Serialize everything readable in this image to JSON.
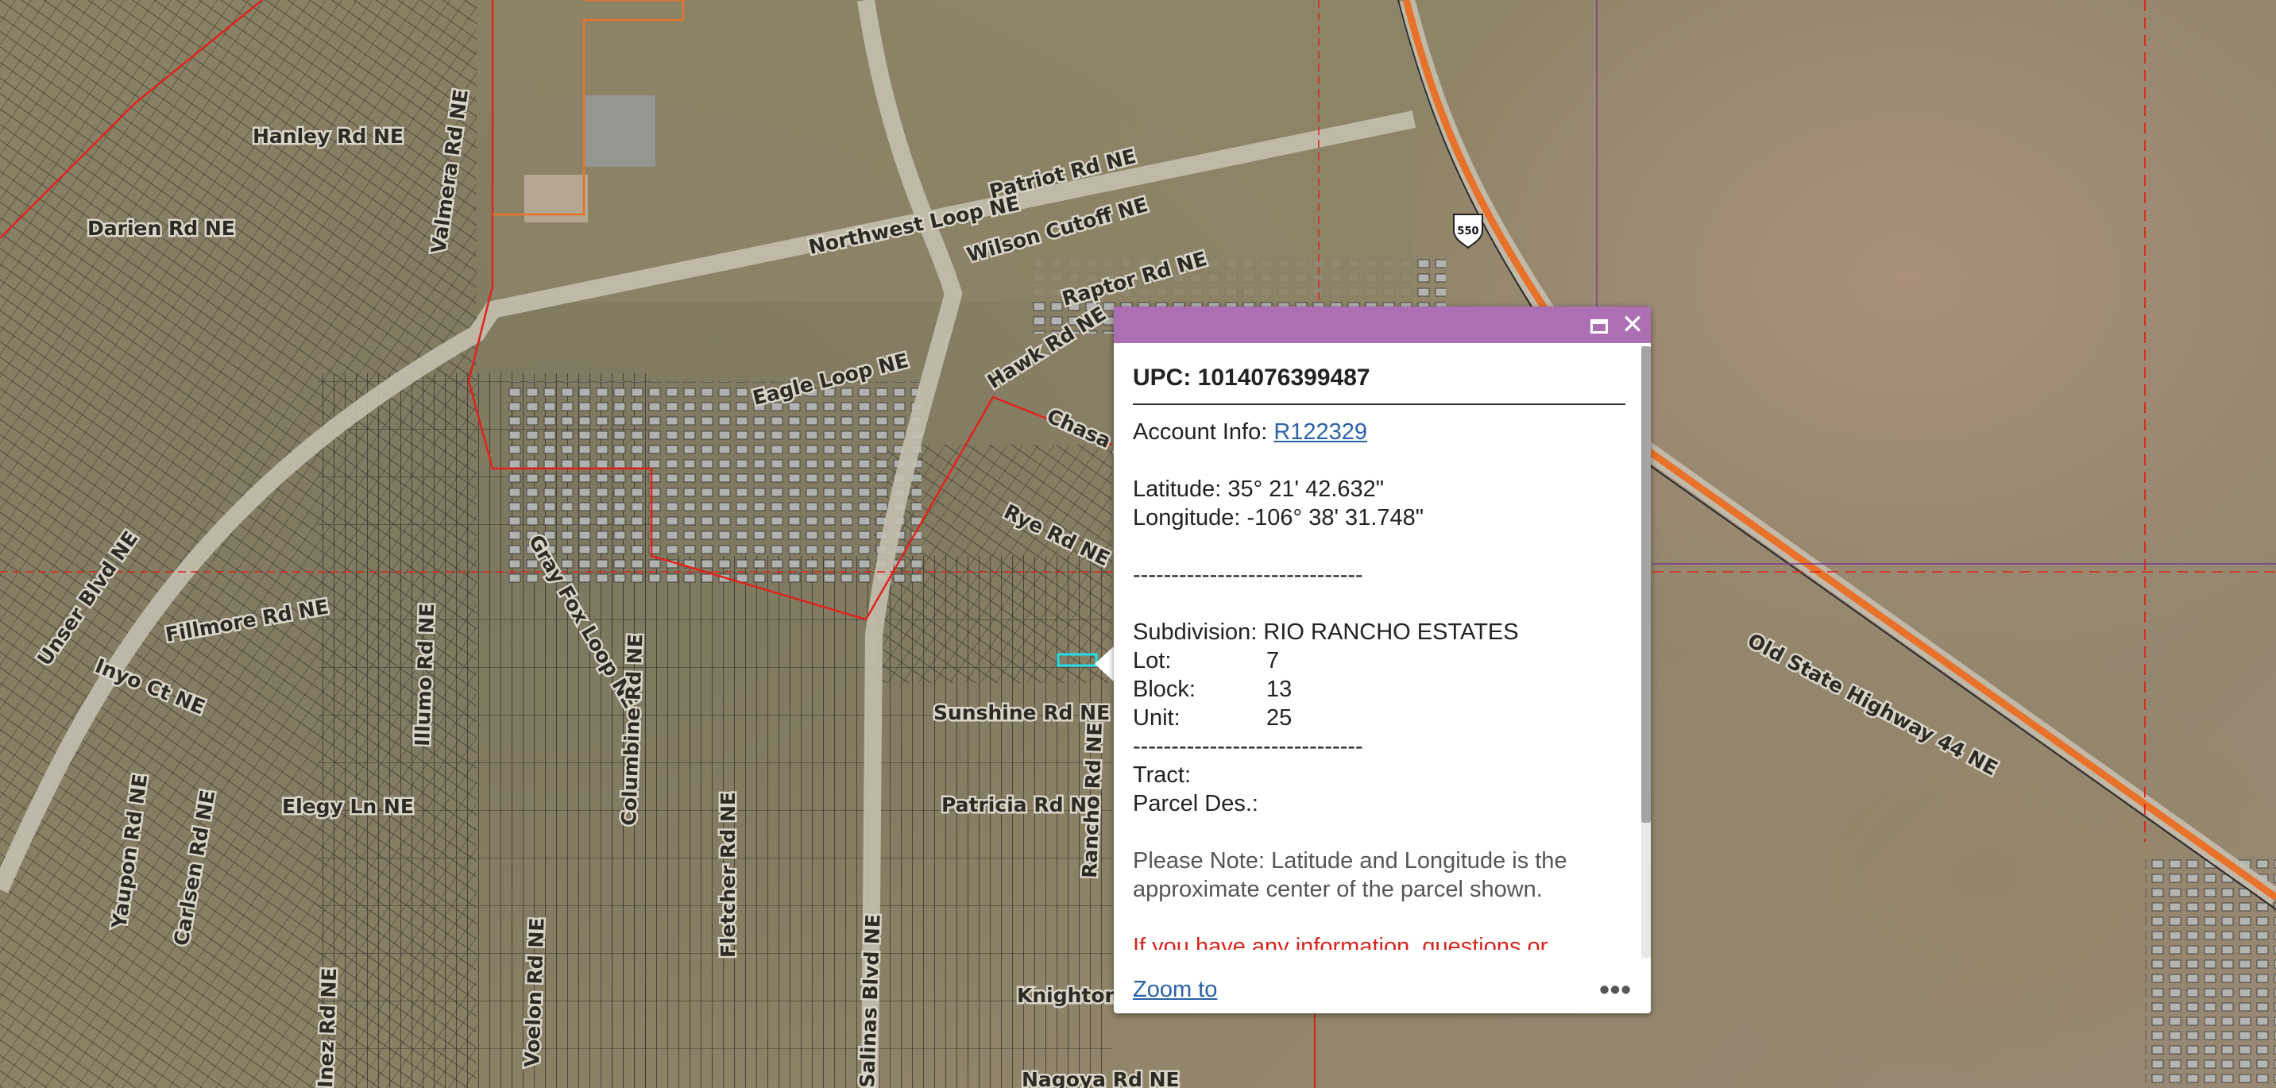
{
  "map": {
    "roads": [
      "Hanley Rd NE",
      "Darien Rd NE",
      "Valmera Rd NE",
      "Patriot Rd NE",
      "Northwest Loop NE",
      "Wilson Cutoff NE",
      "Raptor Rd NE",
      "Eagle Loop NE",
      "Hawk Rd NE",
      "Rye Rd NE",
      "Chasa Rd NE",
      "Fillmore Rd NE",
      "Inyo Ct NE",
      "Gray Fox Loop NE",
      "Illumo Rd NE",
      "Columbine Rd NE",
      "Sunshine Rd NE",
      "Patricia Rd NE",
      "Elegy Ln NE",
      "Yaupon Rd NE",
      "Carlsen Rd NE",
      "Fletcher Rd NE",
      "Voelon Rd NE",
      "Knighton Rd NE",
      "Nagoya Rd NE",
      "Old State Highway 44 NE",
      "Unser Blvd NE",
      "Salinas Blvd NE",
      "Inez Rd NE",
      "Rancho Rd NE"
    ],
    "shield": "550",
    "colors": {
      "parcel_line": "#1f1f1f",
      "boundary": "#e0231c",
      "highway": "#e8722a",
      "district": "#7a3b8c"
    }
  },
  "popup": {
    "header_color": "#ad6fb3",
    "maximize_icon": "maximize-icon",
    "close_icon": "close-icon",
    "close_symbol": "✕",
    "upc_label": "UPC: 1014076399487",
    "account_label": "Account Info:",
    "account_link": "R122329",
    "latitude": "Latitude: 35° 21' 42.632\"",
    "longitude": "Longitude: -106° 38' 31.748\"",
    "dashes1": "------------------------------",
    "subdivision": "Subdivision: RIO RANCHO ESTATES",
    "lot_label": "Lot:",
    "lot_value": "7",
    "block_label": "Block:",
    "block_value": "13",
    "unit_label": "Unit:",
    "unit_value": "25",
    "dashes2": "------------------------------",
    "tract": "Tract:",
    "parcel_des": "Parcel Des.:",
    "note": "Please Note: Latitude and Longitude is the approximate center of the parcel shown.",
    "warning": "If you have any information, questions or concerns about this parcel, please contact",
    "zoom_to": "Zoom to",
    "more": "•••"
  }
}
